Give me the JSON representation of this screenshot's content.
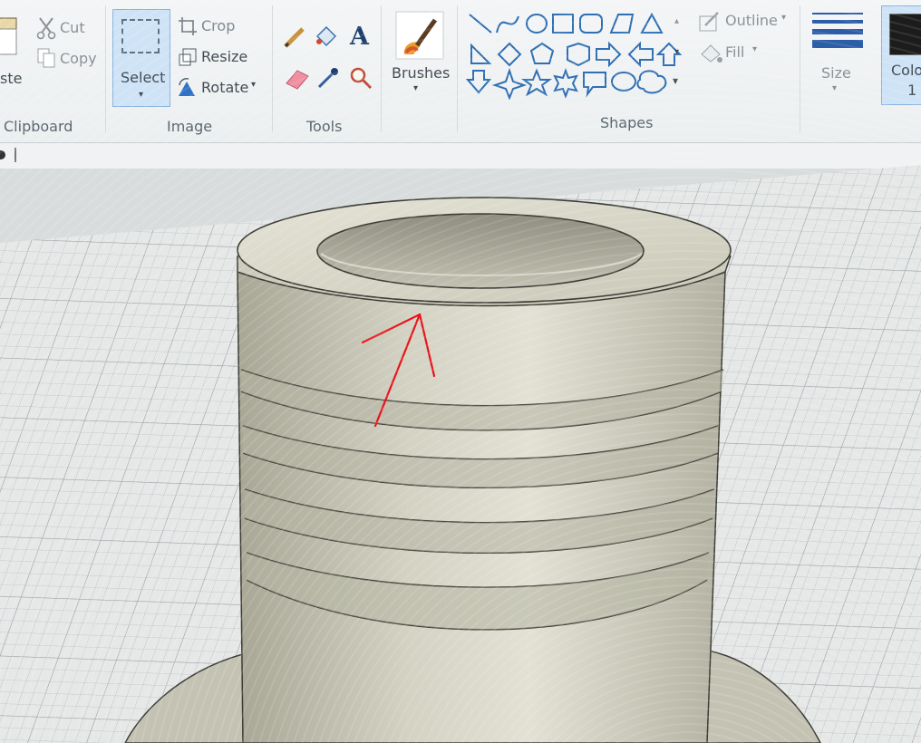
{
  "ribbon": {
    "clipboard": {
      "paste_label": "ste",
      "cut_label": "Cut",
      "copy_label": "Copy",
      "group_label": "Clipboard"
    },
    "image": {
      "select_label": "Select",
      "crop_label": "Crop",
      "resize_label": "Resize",
      "rotate_label": "Rotate",
      "group_label": "Image"
    },
    "tools": {
      "group_label": "Tools",
      "text_glyph": "A"
    },
    "brushes": {
      "label": "Brushes"
    },
    "shapes": {
      "outline_label": "Outline",
      "fill_label": "Fill",
      "group_label": "Shapes"
    },
    "size": {
      "label": "Size"
    },
    "color1": {
      "label_line1": "Colo",
      "label_line2": "1"
    }
  },
  "colors": {
    "arrow": "#e8141c",
    "ribbon_selected": "#cfe3f6",
    "color1_swatch": "#1c1c1c",
    "model": "#c9c8b8"
  },
  "icons": [
    "scissors-icon",
    "copy-icon",
    "paste-icon",
    "crop-icon",
    "resize-icon",
    "rotate-icon",
    "pencil-icon",
    "fill-bucket-icon",
    "text-icon",
    "eraser-icon",
    "color-picker-icon",
    "magnifier-icon",
    "brush-icon",
    "outline-icon",
    "fill-icon",
    "size-lines-icon"
  ]
}
